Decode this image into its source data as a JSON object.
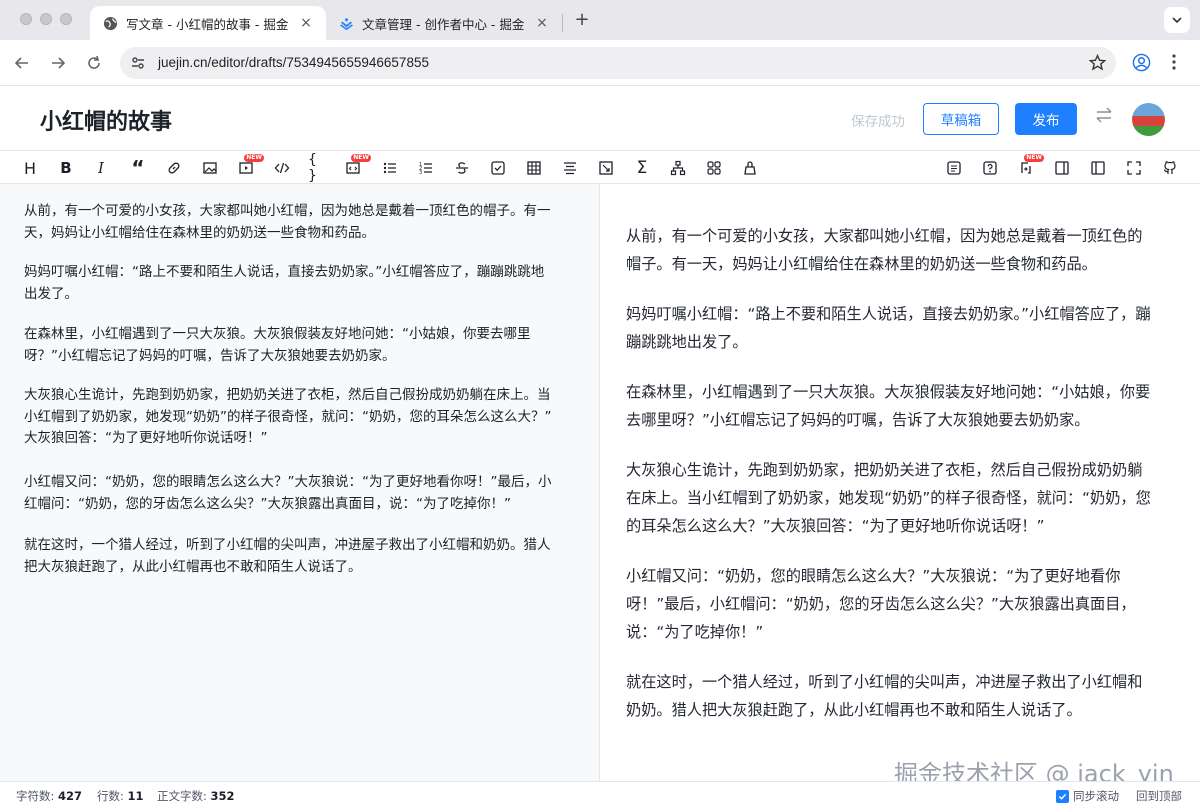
{
  "browser": {
    "tabs": [
      {
        "label": "写文章 - 小红帽的故事 - 掘金",
        "active": true
      },
      {
        "label": "文章管理 - 创作者中心 - 掘金",
        "active": false
      }
    ],
    "url": "juejin.cn/editor/drafts/7534945655946657855"
  },
  "header": {
    "title": "小红帽的故事",
    "save_status": "保存成功",
    "draft_label": "草稿箱",
    "publish_label": "发布",
    "accent_color": "#1e80ff"
  },
  "toolbar": {
    "left_icons": [
      "heading-icon",
      "bold-icon",
      "italic-icon",
      "quote-icon",
      "link-icon",
      "image-icon",
      "video-icon",
      "code-inline-icon",
      "code-block-icon",
      "embed-icon",
      "unordered-list-icon",
      "ordered-list-icon",
      "strikethrough-icon",
      "task-list-icon",
      "table-icon",
      "align-icon",
      "screenshot-icon",
      "formula-icon",
      "diagram-icon",
      "plugin-icon",
      "theme-icon"
    ],
    "right_icons": [
      "toc-icon",
      "help-icon",
      "sync-icon",
      "preview-only-icon",
      "editor-only-icon",
      "fullscreen-icon",
      "github-icon"
    ],
    "new_badge": "NEW"
  },
  "content": {
    "paragraphs": [
      "从前，有一个可爱的小女孩，大家都叫她小红帽，因为她总是戴着一顶红色的帽子。有一天，妈妈让小红帽给住在森林里的奶奶送一些食物和药品。",
      "妈妈叮嘱小红帽：“路上不要和陌生人说话，直接去奶奶家。”小红帽答应了，蹦蹦跳跳地出发了。",
      "在森林里，小红帽遇到了一只大灰狼。大灰狼假装友好地问她：“小姑娘，你要去哪里呀？”小红帽忘记了妈妈的叮嘱，告诉了大灰狼她要去奶奶家。",
      "大灰狼心生诡计，先跑到奶奶家，把奶奶关进了衣柜，然后自己假扮成奶奶躺在床上。当小红帽到了奶奶家，她发现“奶奶”的样子很奇怪，就问：“奶奶，您的耳朵怎么这么大？”大灰狼回答：“为了更好地听你说话呀！”",
      "小红帽又问：“奶奶，您的眼睛怎么这么大？”大灰狼说：“为了更好地看你呀！”最后，小红帽问：“奶奶，您的牙齿怎么这么尖？”大灰狼露出真面目，说：“为了吃掉你！”",
      "就在这时，一个猎人经过，听到了小红帽的尖叫声，冲进屋子救出了小红帽和奶奶。猎人把大灰狼赶跑了，从此小红帽再也不敢和陌生人说话了。"
    ],
    "editor_lines": [
      [
        "从前，有一个可爱的小女孩，大家都叫她小红帽，因为她总是戴着一顶红色的帽子。有一",
        "天，妈妈让小红帽给住在森林里的奶奶送一些食物和药品。"
      ],
      [
        "妈妈叮嘱小红帽：“路上不要和陌生人说话，直接去奶奶家。”小红帽答应了，蹦蹦跳跳地",
        "出发了。"
      ],
      [
        "在森林里，小红帽遇到了一只大灰狼。大灰狼假装友好地问她：“小姑娘，你要去哪里",
        "呀？”小红帽忘记了妈妈的叮嘱，告诉了大灰狼她要去奶奶家。"
      ],
      [
        "大灰狼心生诡计，先跑到奶奶家，把奶奶关进了衣柜，然后自己假扮成奶奶躺在床上。当",
        "小红帽到了奶奶家，她发现“奶奶”的样子很奇怪，就问：“奶奶，您的耳朵怎么这么大？”",
        "大灰狼回答：“为了更好地听你说话呀！”"
      ],
      [
        "小红帽又问：“奶奶，您的眼睛怎么这么大？”大灰狼说：“为了更好地看你呀！”最后，小",
        "红帽问：“奶奶，您的牙齿怎么这么尖？”大灰狼露出真面目，说：“为了吃掉你！”"
      ],
      [
        "就在这时，一个猎人经过，听到了小红帽的尖叫声，冲进屋子救出了小红帽和奶奶。猎人",
        "把大灰狼赶跑了，从此小红帽再也不敢和陌生人说话了。"
      ]
    ],
    "preview_lines": [
      [
        "从前，有一个可爱的小女孩，大家都叫她小红帽，因为她总是戴着一顶红色的",
        "帽子。有一天，妈妈让小红帽给住在森林里的奶奶送一些食物和药品。"
      ],
      [
        "妈妈叮嘱小红帽：“路上不要和陌生人说话，直接去奶奶家。”小红帽答应了，蹦",
        "蹦跳跳地出发了。"
      ],
      [
        "在森林里，小红帽遇到了一只大灰狼。大灰狼假装友好地问她：“小姑娘，你要",
        "去哪里呀？”小红帽忘记了妈妈的叮嘱，告诉了大灰狼她要去奶奶家。"
      ],
      [
        "大灰狼心生诡计，先跑到奶奶家，把奶奶关进了衣柜，然后自己假扮成奶奶躺",
        "在床上。当小红帽到了奶奶家，她发现“奶奶”的样子很奇怪，就问：“奶奶，您",
        "的耳朵怎么这么大？”大灰狼回答：“为了更好地听你说话呀！”"
      ],
      [
        "小红帽又问：“奶奶，您的眼睛怎么这么大？”大灰狼说：“为了更好地看你",
        "呀！”最后，小红帽问：“奶奶，您的牙齿怎么这么尖？”大灰狼露出真面目，",
        "说：“为了吃掉你！”"
      ],
      [
        "就在这时，一个猎人经过，听到了小红帽的尖叫声，冲进屋子救出了小红帽和",
        "奶奶。猎人把大灰狼赶跑了，从此小红帽再也不敢和陌生人说话了。"
      ]
    ],
    "watermark": "掘金技术社区 @ jack_yin"
  },
  "statusbar": {
    "char_count_label": "字符数:",
    "char_count": "427",
    "line_count_label": "行数:",
    "line_count": "11",
    "body_chars_label": "正文字数:",
    "body_chars": "352",
    "sync_scroll_label": "同步滚动",
    "sync_scroll_checked": true,
    "back_to_top_label": "回到顶部"
  }
}
